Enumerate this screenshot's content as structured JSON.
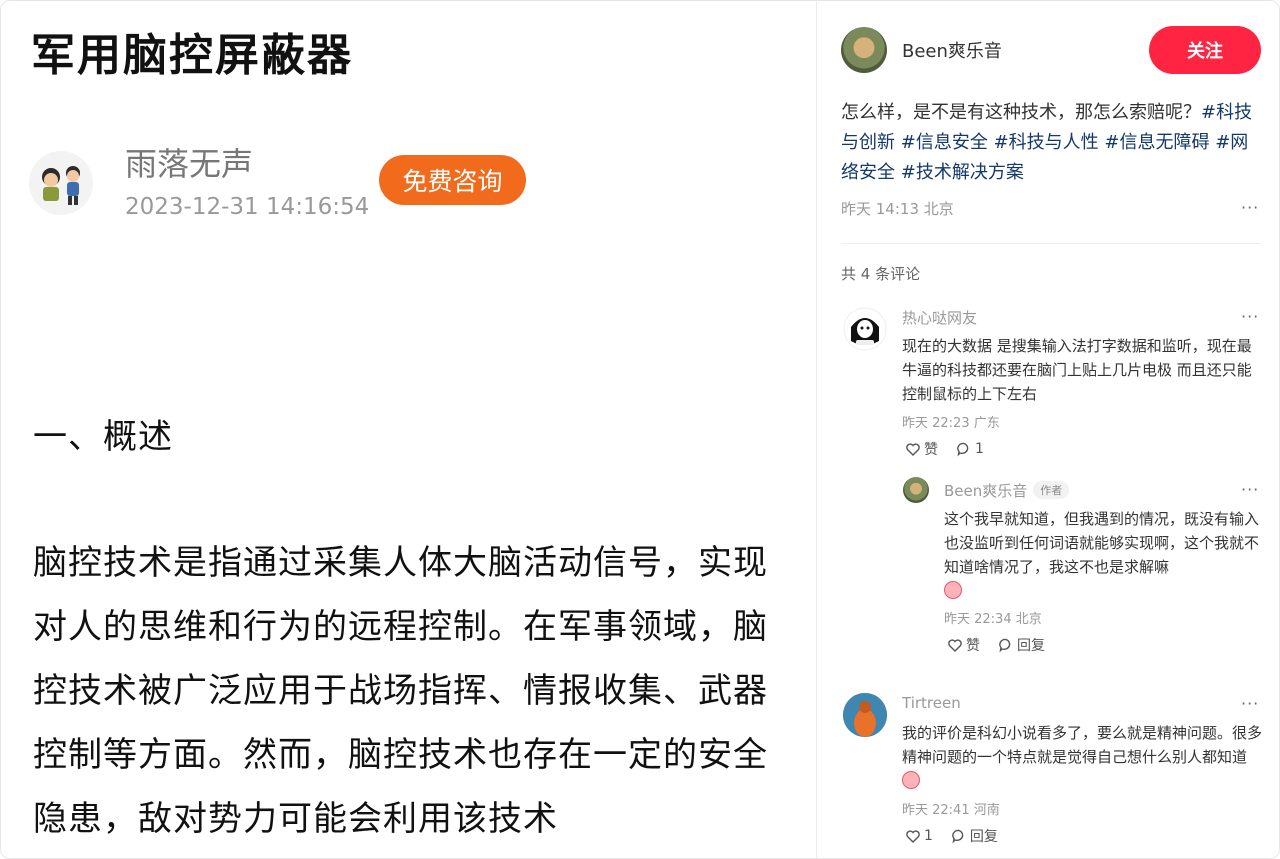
{
  "article": {
    "title": "军用脑控屏蔽器",
    "author_name": "雨落无声",
    "author_date": "2023-12-31 14:16:54",
    "consult_button": "免费咨询",
    "section_heading": "一、概述",
    "body": "脑控技术是指通过采集人体大脑活动信号，实现对人的思维和行为的远程控制。在军事领域，脑控技术被广泛应用于战场指挥、情报收集、武器控制等方面。然而，脑控技术也存在一定的安全隐患，敌对势力可能会利用该技术"
  },
  "panel": {
    "author": "Been爽乐音",
    "follow_button": "关注",
    "post_text": "怎么样，是不是有这种技术，那怎么索赔呢？",
    "tags": [
      "#科技与创新",
      "#信息安全",
      "#科技与人性",
      "#信息无障碍",
      "#网络安全",
      "#技术解决方案"
    ],
    "post_meta": "昨天 14:13 北京",
    "more": "···",
    "comment_count": "共 4 条评论",
    "comments": [
      {
        "name": "热心哒网友",
        "text": "现在的大数据 是搜集输入法打字数据和监听，现在最牛逼的科技都还要在脑门上贴上几片电极 而且还只能控制鼠标的上下左右",
        "meta": "昨天 22:23 广东",
        "like": "赞",
        "reply": "1"
      },
      {
        "name": "Been爽乐音",
        "badge": "作者",
        "text": "这个我早就知道，但我遇到的情况，既没有输入也没监听到任何词语就能够实现啊，这个我就不知道啥情况了，我这不也是求解嘛",
        "meta": "昨天 22:34 北京",
        "like": "赞",
        "reply": "回复"
      },
      {
        "name": "Tirtreen",
        "text": "我的评价是科幻小说看多了，要么就是精神问题。很多精神问题的一个特点就是觉得自己想什么别人都知道",
        "meta": "昨天 22:41 河南",
        "like": "1",
        "reply": "回复"
      }
    ]
  }
}
